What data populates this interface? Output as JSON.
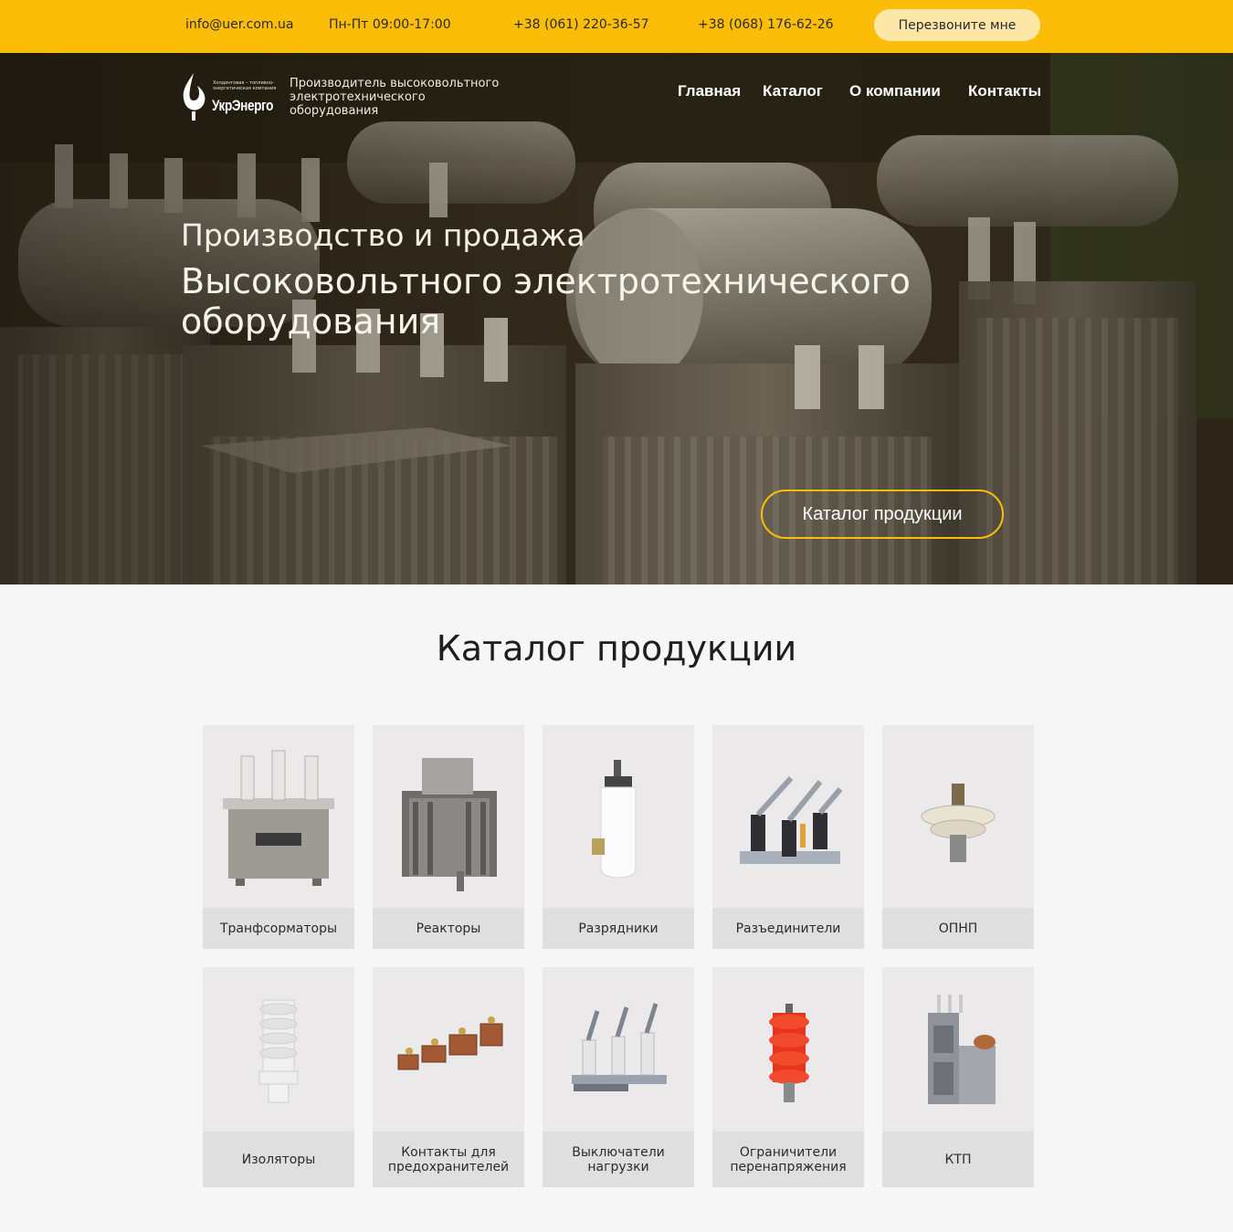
{
  "topbar": {
    "email": "info@uer.com.ua",
    "hours": "Пн-Пт 09:00-17:00",
    "phone1": "+38 (061) 220-36-57",
    "phone2": "+38 (068) 176-62-26",
    "callback_label": "Перезвоните мне"
  },
  "header": {
    "logo_small_text": "Холдинговая – топливно-энергетическая компания",
    "logo_name": "УкрЭнерго",
    "tagline": "Производитель высоковольтного электротехнического оборудования",
    "nav": [
      "Главная",
      "Каталог",
      "О компании",
      "Контакты"
    ]
  },
  "hero": {
    "subtitle": "Производство и продажа",
    "title": "Высоковольтного электротехнического оборудования",
    "button_label": "Каталог продукции"
  },
  "catalog": {
    "title": "Каталог продукции",
    "items": [
      {
        "label": "Транфсорматоры",
        "icon": "transformer-icon"
      },
      {
        "label": "Реакторы",
        "icon": "reactor-icon"
      },
      {
        "label": "Разрядники",
        "icon": "arrester-icon"
      },
      {
        "label": "Разъединители",
        "icon": "disconnector-icon"
      },
      {
        "label": "ОПНП",
        "icon": "surge-limiter-icon"
      },
      {
        "label": "Изоляторы",
        "icon": "insulator-icon"
      },
      {
        "label": "Контакты для предохранителей",
        "icon": "fuse-contacts-icon"
      },
      {
        "label": "Выключатели нагрузки",
        "icon": "load-switch-icon"
      },
      {
        "label": "Ограничители перенапряжения",
        "icon": "overvoltage-limiter-icon"
      },
      {
        "label": "КТП",
        "icon": "substation-icon"
      }
    ]
  },
  "colors": {
    "accent": "#fbbd08",
    "callback_bg": "#fde7a6",
    "card_bg": "#ebe9ea"
  }
}
